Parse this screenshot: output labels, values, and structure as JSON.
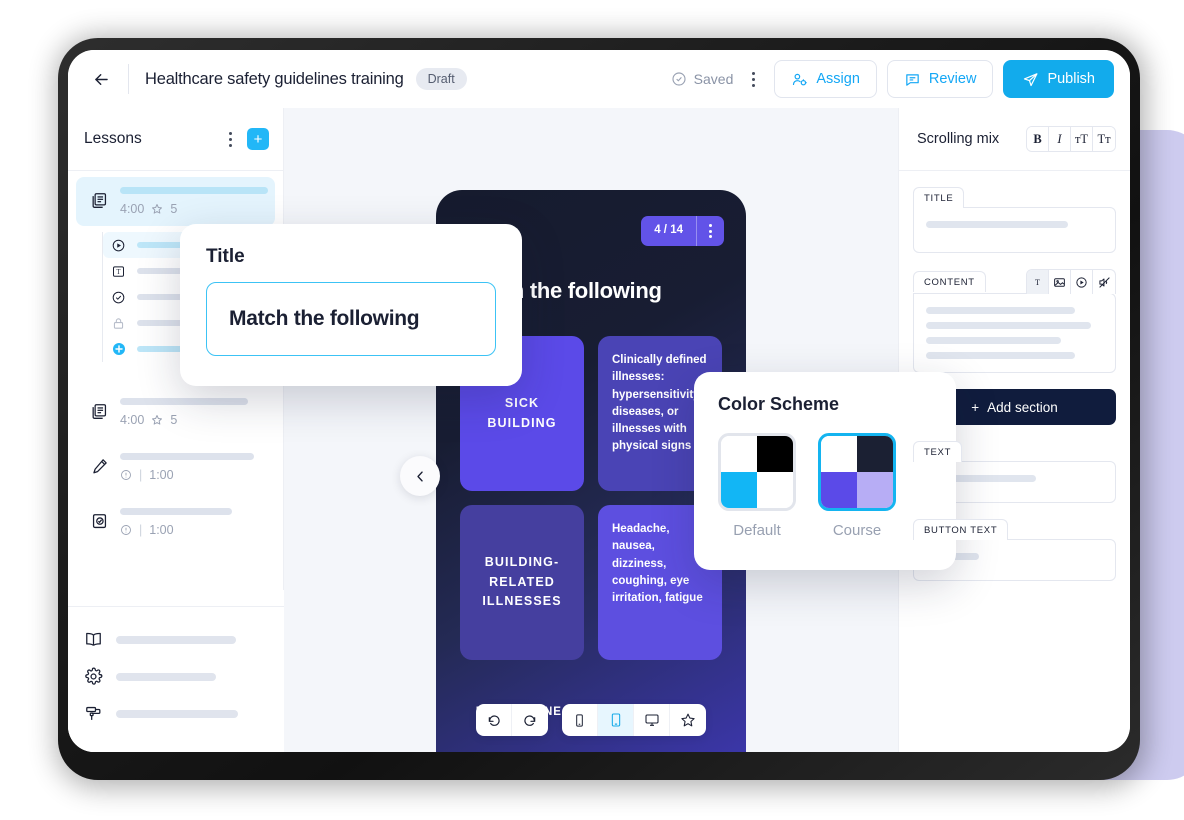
{
  "topbar": {
    "back_icon": "arrow-left-icon",
    "title": "Healthcare safety guidelines training",
    "status_badge": "Draft",
    "saved_label": "Saved",
    "saved_icon": "check-circle-icon",
    "more_icon": "kebab-menu-icon",
    "assign_label": "Assign",
    "assign_icon": "user-assign-icon",
    "review_label": "Review",
    "review_icon": "comment-icon",
    "publish_label": "Publish",
    "publish_icon": "send-icon"
  },
  "sidebar": {
    "heading": "Lessons",
    "more_icon": "kebab-menu-icon",
    "add_icon": "plus-icon",
    "lessons": [
      {
        "icon": "slides-icon",
        "duration": "4:00",
        "score": "5",
        "score_icon": "star-icon",
        "active": true
      },
      {
        "icon": "slides-icon",
        "duration": "4:00",
        "score": "5",
        "score_icon": "star-icon",
        "active": false
      },
      {
        "icon": "pencil-icon",
        "duration": "1:00",
        "info_icon": "info-icon",
        "active": false
      },
      {
        "icon": "quiz-icon",
        "duration": "1:00",
        "info_icon": "info-icon",
        "active": false
      }
    ],
    "sublist": [
      {
        "icon": "play-circle-icon",
        "active": true
      },
      {
        "icon": "text-box-icon",
        "active": false
      },
      {
        "icon": "check-circle-icon",
        "active": false
      },
      {
        "icon": "lock-icon",
        "active": false
      },
      {
        "icon": "plus-circle-icon",
        "active": false
      }
    ],
    "bottom_nav": [
      {
        "icon": "book-icon"
      },
      {
        "icon": "gear-icon"
      },
      {
        "icon": "paint-roller-icon"
      }
    ]
  },
  "canvas": {
    "prev_icon": "chevron-left-icon",
    "phone": {
      "page_indicator": "4 / 14",
      "menu_icon": "kebab-menu-icon",
      "slide_title": "Match the following",
      "footer_hint": "DRAW A LINE BETWEEN EACH PAIR",
      "cards": [
        {
          "kind": "term",
          "text": "SICK BUILDING",
          "color": "#5b4ae8"
        },
        {
          "kind": "definition",
          "text": "Clinically defined illnesses: hypersensitivity diseases, or illnesses with physical signs",
          "color": "#4a44b5"
        },
        {
          "kind": "term",
          "text": "BUILDING-RELATED ILLNESSES",
          "color": "#453f9f"
        },
        {
          "kind": "definition",
          "text": "Headache, nausea, dizziness, coughing, eye irritation, fatigue",
          "color": "#5d4fe0"
        }
      ]
    },
    "toolbar": {
      "undo_icon": "undo-icon",
      "redo_icon": "redo-icon",
      "devices": [
        {
          "icon": "mobile-icon",
          "selected": false
        },
        {
          "icon": "tablet-icon",
          "selected": true
        },
        {
          "icon": "desktop-icon",
          "selected": false
        },
        {
          "icon": "star-icon",
          "selected": false
        }
      ]
    }
  },
  "right_panel": {
    "title": "Scrolling mix",
    "text_tools": [
      {
        "icon": "bold-icon",
        "label": "B"
      },
      {
        "icon": "italic-icon",
        "label": "I"
      },
      {
        "icon": "font-size-large-icon",
        "label": "ᴛT"
      },
      {
        "icon": "font-size-small-icon",
        "label": "Tᴛ"
      }
    ],
    "fields": [
      {
        "label": "TITLE",
        "lines": [
          80
        ]
      },
      {
        "label": "CONTENT",
        "lines": [
          84,
          92,
          76,
          84
        ],
        "tools": [
          {
            "icon": "text-icon",
            "selected": true
          },
          {
            "icon": "image-icon",
            "selected": false
          },
          {
            "icon": "video-icon",
            "selected": false
          },
          {
            "icon": "audio-off-icon",
            "selected": false
          }
        ]
      }
    ],
    "add_section_label": "Add section",
    "add_section_icon": "plus-icon",
    "extra_fields": [
      {
        "label": "TEXT",
        "lines": [
          62
        ]
      },
      {
        "label": "BUTTON TEXT",
        "lines": [
          30
        ]
      }
    ]
  },
  "popups": {
    "title_card": {
      "heading": "Title",
      "value": "Match the following",
      "accent": "#3cc3f5"
    },
    "color_scheme": {
      "heading": "Color Scheme",
      "options": [
        {
          "name": "Default",
          "selected": false,
          "quadrants": [
            "#ffffff",
            "#000000",
            "#12b6f5",
            "#ffffff"
          ]
        },
        {
          "name": "Course",
          "selected": true,
          "quadrants": [
            "#ffffff",
            "#1b2033",
            "#5b4ae8",
            "#b7adf5"
          ]
        }
      ]
    }
  },
  "decor": {
    "panel_color": "#cdcbef"
  }
}
